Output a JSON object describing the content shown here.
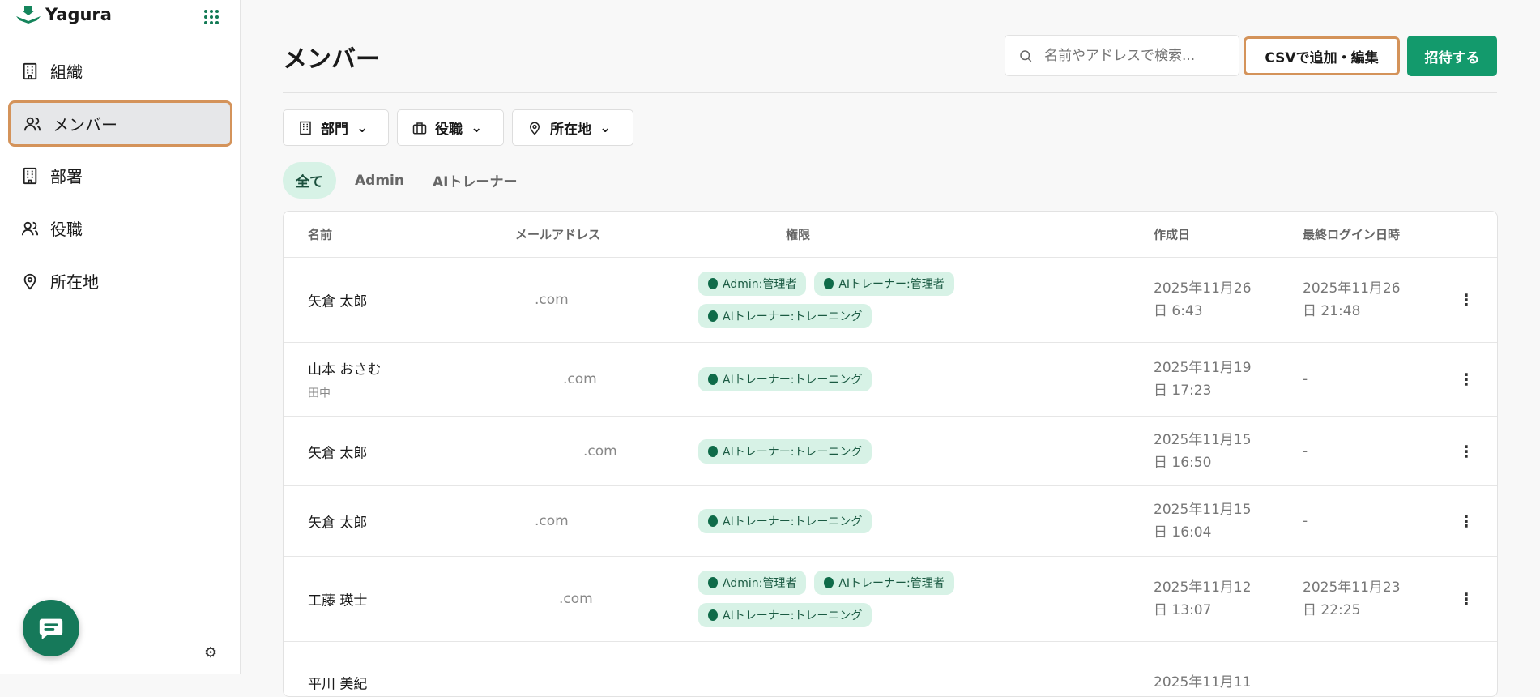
{
  "app": {
    "name": "Yagura"
  },
  "sidebar": {
    "items": [
      {
        "label": "組織",
        "icon": "building-icon"
      },
      {
        "label": "メンバー",
        "icon": "users-icon",
        "active": true
      },
      {
        "label": "部署",
        "icon": "building-icon"
      },
      {
        "label": "役職",
        "icon": "users-icon"
      },
      {
        "label": "所在地",
        "icon": "map-pin-icon"
      }
    ]
  },
  "header": {
    "title": "メンバー",
    "search_placeholder": "名前やアドレスで検索...",
    "csv_label": "CSVで追加・編集",
    "invite_label": "招待する"
  },
  "filters": [
    {
      "label": "部門"
    },
    {
      "label": "役職"
    },
    {
      "label": "所在地"
    }
  ],
  "tabs": [
    {
      "label": "全て",
      "active": true
    },
    {
      "label": "Admin"
    },
    {
      "label": "AIトレーナー"
    }
  ],
  "table": {
    "columns": [
      "名前",
      "メールアドレス",
      "権限",
      "作成日",
      "最終ログイン日時"
    ],
    "rows": [
      {
        "name": "矢倉 太郎",
        "sub": "",
        "email": ".com",
        "roles": [
          "Admin:管理者",
          "AIトレーナー:管理者",
          "AIトレーナー:トレーニング"
        ],
        "created": [
          "2025年11月26",
          "日 6:43"
        ],
        "last": [
          "2025年11月26",
          "日 21:48"
        ]
      },
      {
        "name": "山本 おさむ",
        "sub": "田中",
        "email": ".com",
        "roles": [
          "AIトレーナー:トレーニング"
        ],
        "created": [
          "2025年11月19",
          "日 17:23"
        ],
        "last": [
          "-",
          ""
        ]
      },
      {
        "name": "矢倉 太郎",
        "sub": "",
        "email": ".com",
        "roles": [
          "AIトレーナー:トレーニング"
        ],
        "created": [
          "2025年11月15",
          "日 16:50"
        ],
        "last": [
          "-",
          ""
        ]
      },
      {
        "name": "矢倉 太郎",
        "sub": "",
        "email": ".com",
        "roles": [
          "AIトレーナー:トレーニング"
        ],
        "created": [
          "2025年11月15",
          "日 16:04"
        ],
        "last": [
          "-",
          ""
        ]
      },
      {
        "name": "工藤 瑛士",
        "sub": "",
        "email": ".com",
        "roles": [
          "Admin:管理者",
          "AIトレーナー:管理者",
          "AIトレーナー:トレーニング"
        ],
        "created": [
          "2025年11月12",
          "日 13:07"
        ],
        "last": [
          "2025年11月23",
          "日 22:25"
        ]
      },
      {
        "name": "平川 美紀",
        "sub": "",
        "email": "",
        "roles": [],
        "created": [
          "2025年11月11",
          ""
        ],
        "last": [
          "",
          ""
        ]
      }
    ]
  },
  "colors": {
    "accent": "#139a6c",
    "highlight": "#d4935a",
    "badge_bg": "#d7f2e6"
  }
}
